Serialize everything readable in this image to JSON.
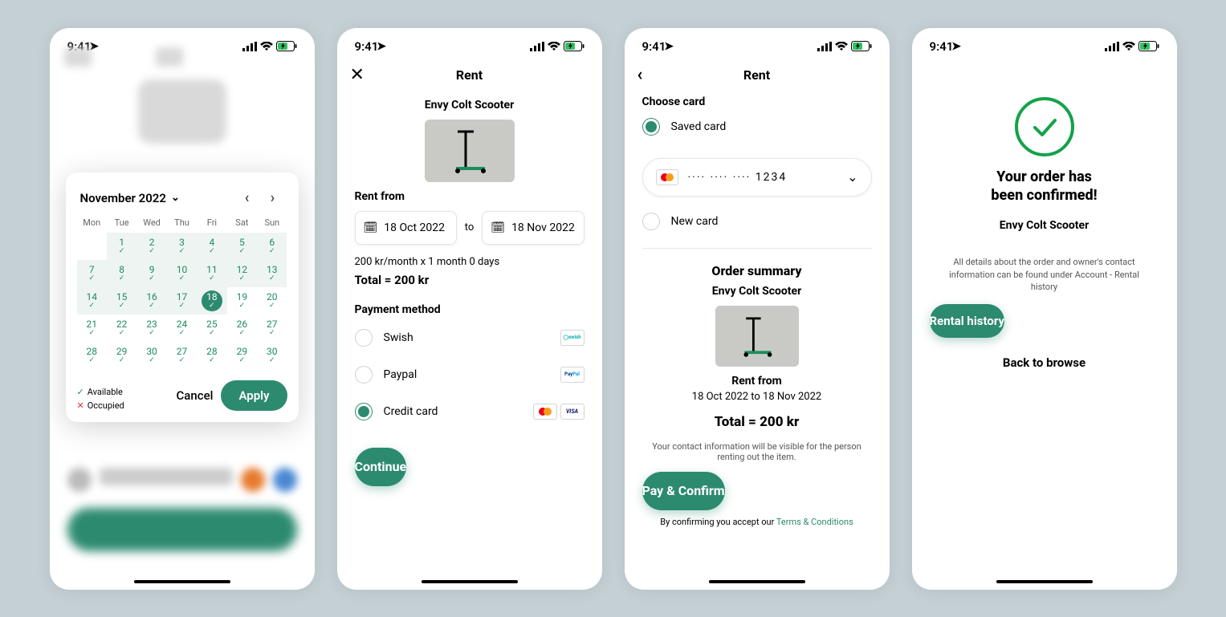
{
  "status": {
    "time": "9:41"
  },
  "screen1": {
    "month_label": "November 2022",
    "dow": [
      "Mon",
      "Tue",
      "Wed",
      "Thu",
      "Fri",
      "Sat",
      "Sun"
    ],
    "legend_available": "Available",
    "legend_occupied": "Occupied",
    "cancel": "Cancel",
    "apply": "Apply",
    "days": [
      {
        "n": "1",
        "s": "range"
      },
      {
        "n": "2",
        "s": "range"
      },
      {
        "n": "3",
        "s": "range"
      },
      {
        "n": "4",
        "s": "range"
      },
      {
        "n": "5",
        "s": "range"
      },
      {
        "n": "6",
        "s": "range"
      },
      {
        "n": "7",
        "s": "range"
      },
      {
        "n": "8",
        "s": "range"
      },
      {
        "n": "9",
        "s": "range"
      },
      {
        "n": "10",
        "s": "range"
      },
      {
        "n": "11",
        "s": "range"
      },
      {
        "n": "12",
        "s": "range"
      },
      {
        "n": "13",
        "s": "range"
      },
      {
        "n": "14",
        "s": "range"
      },
      {
        "n": "15",
        "s": "range"
      },
      {
        "n": "16",
        "s": "range"
      },
      {
        "n": "17",
        "s": "range"
      },
      {
        "n": "18",
        "s": "selected"
      },
      {
        "n": "19",
        "s": "avail"
      },
      {
        "n": "20",
        "s": "avail"
      },
      {
        "n": "21",
        "s": "avail"
      },
      {
        "n": "22",
        "s": "avail"
      },
      {
        "n": "23",
        "s": "avail"
      },
      {
        "n": "24",
        "s": "avail"
      },
      {
        "n": "25",
        "s": "avail"
      },
      {
        "n": "26",
        "s": "avail"
      },
      {
        "n": "27",
        "s": "avail"
      },
      {
        "n": "28",
        "s": "avail"
      },
      {
        "n": "29",
        "s": "avail"
      },
      {
        "n": "30",
        "s": "avail"
      },
      {
        "n": "27",
        "s": "avail"
      },
      {
        "n": "28",
        "s": "avail"
      },
      {
        "n": "29",
        "s": "avail"
      },
      {
        "n": "30",
        "s": "avail"
      }
    ]
  },
  "screen2": {
    "nav_title": "Rent",
    "product_name": "Envy Colt Scooter",
    "rent_from_label": "Rent from",
    "date_from": "18 Oct 2022",
    "to_label": "to",
    "date_to": "18 Nov 2022",
    "price_line": "200 kr/month  x  1 month 0 days",
    "total_line": "Total = 200 kr",
    "payment_method_label": "Payment method",
    "pm": {
      "swish": "Swish",
      "paypal": "Paypal",
      "credit": "Credit card"
    },
    "continue": "Continue"
  },
  "screen3": {
    "nav_title": "Rent",
    "choose_card": "Choose card",
    "saved_card": "Saved card",
    "new_card": "New card",
    "card_mask": "····  ····  ····  1234",
    "order_summary": "Order summary",
    "product_name": "Envy Colt Scooter",
    "rent_from": "Rent from",
    "dates": "18 Oct 2022  to  18 Nov 2022",
    "total": "Total = 200 kr",
    "contact_note": "Your contact information will be visible for the person renting out the item.",
    "pay_btn": "Pay & Confirm",
    "confirm_prefix": "By confirming you accept our ",
    "terms": "Terms & Conditions"
  },
  "screen4": {
    "title_line1": "Your order has",
    "title_line2": "been confirmed!",
    "product_name": "Envy Colt Scooter",
    "note": "All details about the order and owner's contact information can be found under Account - Rental history",
    "history_btn": "Rental history",
    "back_link": "Back to browse"
  }
}
